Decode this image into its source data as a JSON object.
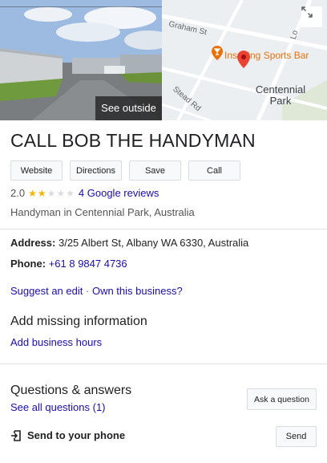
{
  "media": {
    "see_outside_label": "See outside",
    "map": {
      "street_1": "Graham St",
      "street_2": "Stead Rd",
      "street_3": "Lo",
      "poi_label": "Inspiring Sports Bar",
      "area_label": "Centennial Park",
      "poi_color": "#e8710a",
      "pin_color": "#ea4335"
    }
  },
  "business": {
    "name": "CALL BOB THE HANDYMAN",
    "rating": "2.0",
    "rating_value": 2,
    "rating_max": 5,
    "reviews_label": "4 Google reviews",
    "category": "Handyman in Centennial Park, Australia"
  },
  "actions": {
    "website": "Website",
    "directions": "Directions",
    "save": "Save",
    "call": "Call"
  },
  "details": {
    "address_label": "Address:",
    "address_value": "3/25 Albert St, Albany WA 6330, Australia",
    "phone_label": "Phone:",
    "phone_value": "+61 8 9847 4736"
  },
  "edit": {
    "suggest_edit": "Suggest an edit",
    "separator": "·",
    "own_business": "Own this business?"
  },
  "missing_info": {
    "heading": "Add missing information",
    "add_hours": "Add business hours"
  },
  "qa": {
    "heading": "Questions & answers",
    "see_all": "See all questions (1)",
    "ask_button": "Ask a question"
  },
  "send": {
    "label": "Send to your phone",
    "button": "Send"
  },
  "colors": {
    "link": "#1a0dab",
    "star_on": "#f4b400",
    "star_off": "#dadce0"
  }
}
